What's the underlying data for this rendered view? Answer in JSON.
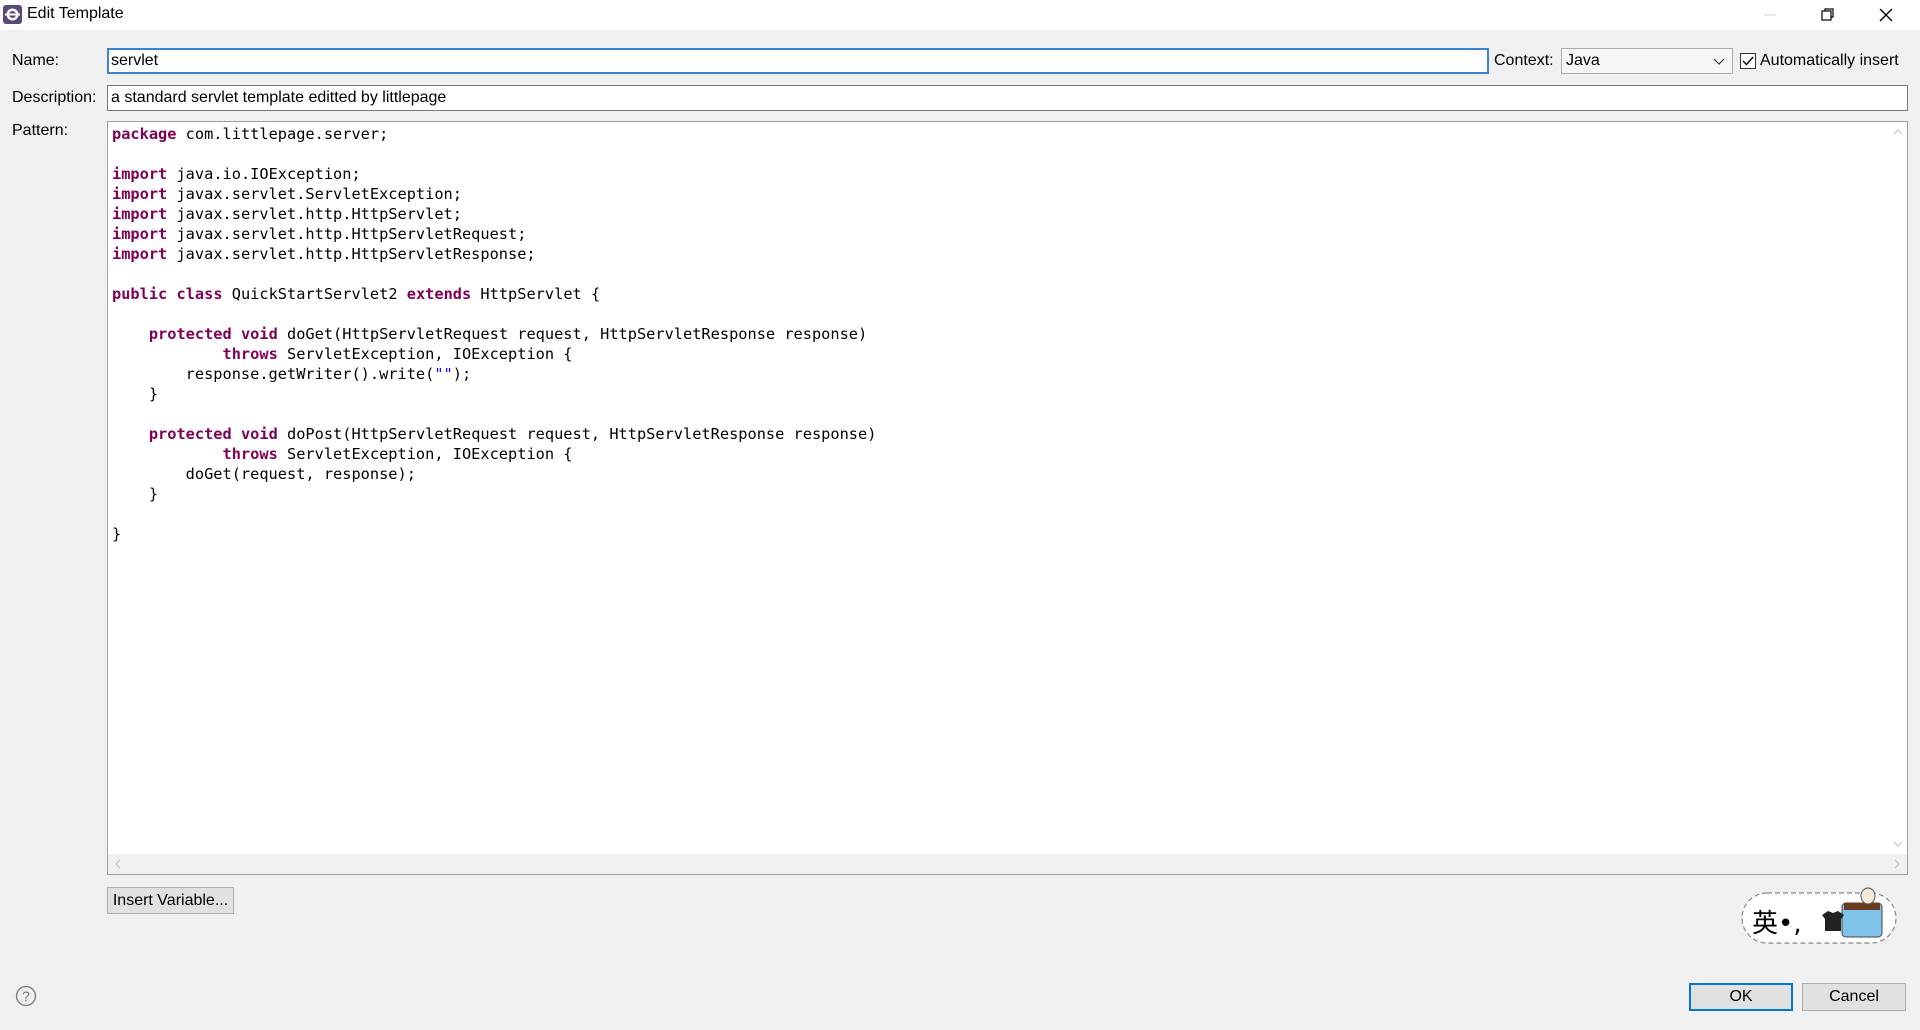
{
  "window": {
    "title": "Edit Template",
    "icons": {
      "app": "eclipse-icon",
      "minimize": "minimize-icon",
      "maximize": "restore-icon",
      "close": "close-icon"
    }
  },
  "form": {
    "name_label": "Name:",
    "name_value": "servlet",
    "context_label": "Context:",
    "context_value": "Java",
    "auto_insert_label": "Automatically insert",
    "auto_insert_checked": true,
    "description_label": "Description:",
    "description_value": "a standard servlet template editted by littlepage",
    "pattern_label": "Pattern:"
  },
  "pattern": {
    "lines": [
      "package com.littlepage.server;",
      "",
      "import java.io.IOException;",
      "import javax.servlet.ServletException;",
      "import javax.servlet.http.HttpServlet;",
      "import javax.servlet.http.HttpServletRequest;",
      "import javax.servlet.http.HttpServletResponse;",
      "",
      "public class QuickStartServlet2 extends HttpServlet {",
      "",
      "    protected void doGet(HttpServletRequest request, HttpServletResponse response)",
      "            throws ServletException, IOException {",
      "        response.getWriter().write(\"\");",
      "    }",
      "",
      "    protected void doPost(HttpServletRequest request, HttpServletResponse response)",
      "            throws ServletException, IOException {",
      "        doGet(request, response);",
      "    }",
      "",
      "}"
    ],
    "keyword_color": "#7f0055",
    "string_color": "#2a00ff"
  },
  "buttons": {
    "insert_variable": "Insert Variable...",
    "ok": "OK",
    "cancel": "Cancel"
  },
  "ime": {
    "text": "英•,"
  },
  "help": {
    "icon": "help-icon"
  }
}
